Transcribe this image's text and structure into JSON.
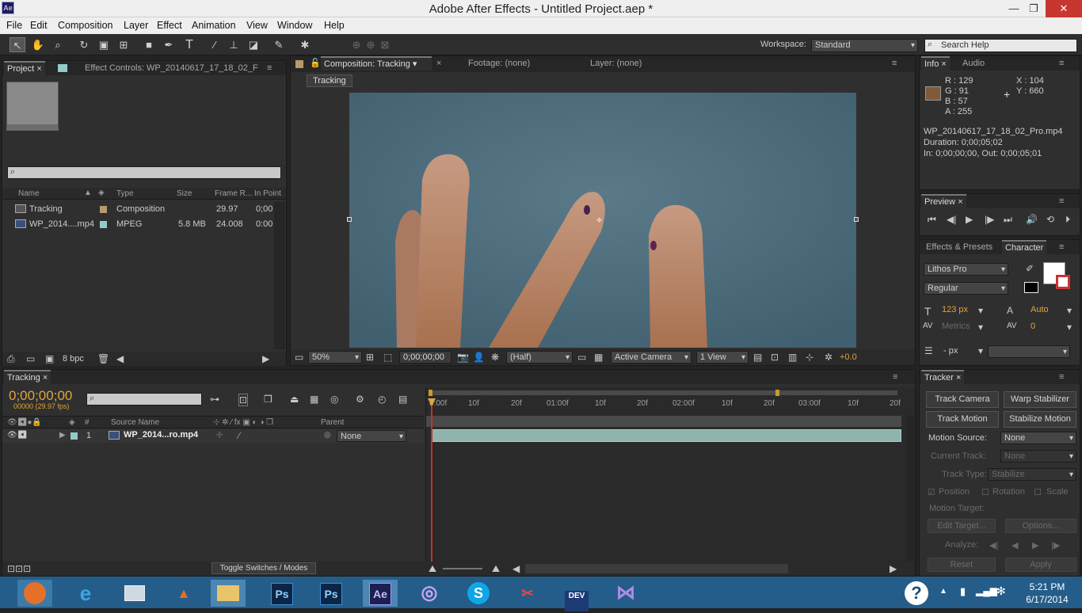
{
  "window": {
    "title": "Adobe After Effects - Untitled Project.aep *",
    "app_icon": "Ae",
    "minimize": "—",
    "maximize": "❐",
    "close": "✕"
  },
  "menu": [
    "File",
    "Edit",
    "Composition",
    "Layer",
    "Effect",
    "Animation",
    "View",
    "Window",
    "Help"
  ],
  "toolbar": {
    "workspace_label": "Workspace:",
    "workspace_value": "Standard",
    "search_placeholder": "Search Help"
  },
  "project": {
    "tab": "Project",
    "effect_controls_tab": "Effect Controls: WP_20140617_17_18_02_F",
    "columns": [
      "Name",
      "Type",
      "Size",
      "Frame R...",
      "In Point"
    ],
    "items": [
      {
        "name": "Tracking",
        "type": "Composition",
        "size": "",
        "fps": "29.97",
        "in": "0;00"
      },
      {
        "name": "WP_2014....mp4",
        "type": "MPEG",
        "size": "5.8 MB",
        "fps": "24.008",
        "in": "0:00"
      }
    ],
    "bpc": "8 bpc"
  },
  "viewer": {
    "comp_tab": "Composition: Tracking",
    "footage_tab": "Footage: (none)",
    "layer_tab": "Layer: (none)",
    "breadcrumb": "Tracking",
    "zoom": "50%",
    "timecode": "0;00;00;00",
    "resolution": "(Half)",
    "camera": "Active Camera",
    "views": "1 View",
    "exposure": "+0.0"
  },
  "info": {
    "tab": "Info",
    "audio_tab": "Audio",
    "R": "R : 129",
    "G": "G : 91",
    "B": "B : 57",
    "A": "A : 255",
    "X": "X : 104",
    "Y": "Y : 660",
    "swatch": "#815b39",
    "file": "WP_20140617_17_18_02_Pro.mp4",
    "duration": "Duration: 0;00;05;02",
    "inout": "In: 0;00;00;00,  Out: 0;00;05;01"
  },
  "preview": {
    "tab": "Preview"
  },
  "character": {
    "effects_tab": "Effects & Presets",
    "tab": "Character",
    "font": "Lithos Pro",
    "style": "Regular",
    "size": "123 px",
    "leading": "Auto",
    "kerning": "Metrics",
    "tracking": "0",
    "stroke": "- px"
  },
  "timeline": {
    "tab": "Tracking",
    "timecode": "0;00;00;00",
    "frames": "00000 (29.97 fps)",
    "source_col": "Source Name",
    "parent_col": "Parent",
    "num_col": "#",
    "layer_num": "1",
    "layer_name": "WP_2014...ro.mp4",
    "parent": "None",
    "toggle": "Toggle Switches / Modes",
    "ruler": [
      "0:00f",
      "10f",
      "20f",
      "01:00f",
      "10f",
      "20f",
      "02:00f",
      "10f",
      "20f",
      "03:00f",
      "10f",
      "20f"
    ]
  },
  "tracker": {
    "tab": "Tracker",
    "track_camera": "Track Camera",
    "warp": "Warp Stabilizer",
    "track_motion": "Track Motion",
    "stabilize": "Stabilize Motion",
    "source_label": "Motion Source:",
    "source_value": "None",
    "current_label": "Current Track:",
    "current_value": "None",
    "type_label": "Track Type:",
    "type_value": "Stabilize",
    "position": "Position",
    "rotation": "Rotation",
    "scale": "Scale",
    "target": "Motion Target:",
    "edit_target": "Edit Target...",
    "options": "Options...",
    "analyze": "Analyze:",
    "reset": "Reset",
    "apply": "Apply"
  },
  "taskbar": {
    "time": "5:21 PM",
    "date": "6/17/2014",
    "apps": [
      "firefox",
      "ie",
      "screenshot",
      "matlab",
      "explorer",
      "photoshop",
      "photoshop",
      "after-effects",
      "chrome-canary",
      "skype",
      "snipping",
      "devcpp",
      "visual-studio"
    ],
    "labels": {
      "ps1": "Ps",
      "ps2": "Ps",
      "ae": "Ae",
      "dev": "DEV",
      "help": "?"
    }
  }
}
